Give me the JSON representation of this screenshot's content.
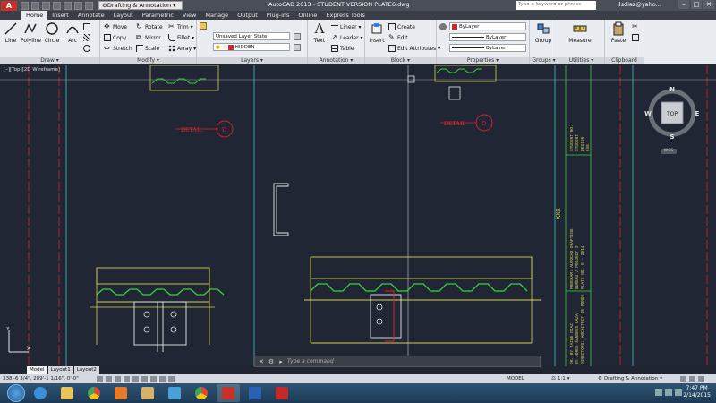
{
  "app": {
    "logo": "A",
    "workspace": "Drafting & Annotation",
    "title": "AutoCAD 2013 - STUDENT VERSION    PLATE6.dwg",
    "search_placeholder": "Type a keyword or phrase",
    "user": "jlsdiaz@yaho...",
    "window_controls": [
      "–",
      "□",
      "✕"
    ]
  },
  "ribbon_tabs": [
    "Home",
    "Insert",
    "Annotate",
    "Layout",
    "Parametric",
    "View",
    "Manage",
    "Output",
    "Plug-ins",
    "Online",
    "Express Tools"
  ],
  "active_tab": "Home",
  "panels": {
    "draw": {
      "title": "Draw ▾",
      "tools": [
        "Line",
        "Polyline",
        "Circle",
        "Arc"
      ]
    },
    "modify": {
      "title": "Modify ▾",
      "tools": [
        "Move",
        "Rotate",
        "Trim ▾",
        "Copy",
        "Mirror",
        "Fillet ▾",
        "Stretch",
        "Scale",
        "Array ▾"
      ]
    },
    "layers": {
      "title": "Layers ▾",
      "layer_state": "Unsaved Layer State",
      "current_layer": "HIDDEN"
    },
    "annotation": {
      "title": "Annotation ▾",
      "text": "Text",
      "tools": [
        "Linear ▾",
        "Leader ▾",
        "Table"
      ]
    },
    "block": {
      "title": "Block ▾",
      "insert": "Insert",
      "tools": [
        "Create",
        "Edit",
        "Edit Attributes ▾"
      ]
    },
    "properties": {
      "title": "Properties ▾",
      "color": "ByLayer",
      "linetype": "ByLayer",
      "lineweight": "ByLayer"
    },
    "groups": {
      "title": "Groups ▾",
      "group": "Group"
    },
    "utilities": {
      "title": "Utilities ▾",
      "measure": "Measure"
    },
    "clipboard": {
      "title": "Clipboard",
      "paste": "Paste"
    }
  },
  "viewport": {
    "label": "[–][Top][2D Wireframe]",
    "detail_labels": [
      "DETAIL",
      "DETAIL"
    ],
    "detail_marks": [
      "D",
      "D"
    ],
    "title_block_lines": [
      "STUDENT NO.",
      "STUDENT",
      "DESIGN",
      "EXE"
    ],
    "sheet_id": "XXX",
    "program_lines": [
      "PROGRAM: AUTOCAD DRAFTING",
      "BUREAU / PROJECT 2",
      "PLATE NO. 6 - 2014"
    ],
    "name_lines": [
      "DR. BY JAIME DIAZ",
      "BY JORGE SANDRES GAZA",
      "DIRECTORS: ARCHITECT DE PONDE"
    ]
  },
  "viewcube": {
    "face": "TOP",
    "north": "N",
    "south": "S",
    "east": "E",
    "west": "W",
    "wcs": "WCS"
  },
  "command": {
    "placeholder": "Type a command"
  },
  "layout_tabs": [
    "Model",
    "Layout1",
    "Layout2"
  ],
  "active_layout": "Model",
  "status": {
    "coords": "338'-6 3/4\", 289'-1 1/16\", 0'-0\"",
    "model": "MODEL",
    "scale": "1:1",
    "workspace": "Drafting & Annotation"
  },
  "taskbar": {
    "apps": [
      "ie",
      "explorer",
      "chrome",
      "media",
      "folder",
      "paint",
      "chrome2",
      "autocad",
      "word",
      "acrobat"
    ],
    "time": "7:47 PM",
    "date": "2/14/2015"
  },
  "colors": {
    "background": "#202634",
    "drawing_red": "#d8232a",
    "drawing_green": "#38d23a",
    "drawing_yellow": "#d4d24a",
    "drawing_cyan": "#3ec3c8",
    "drawing_white": "#e8e8e8",
    "drawing_magenta": "#d340c8"
  }
}
